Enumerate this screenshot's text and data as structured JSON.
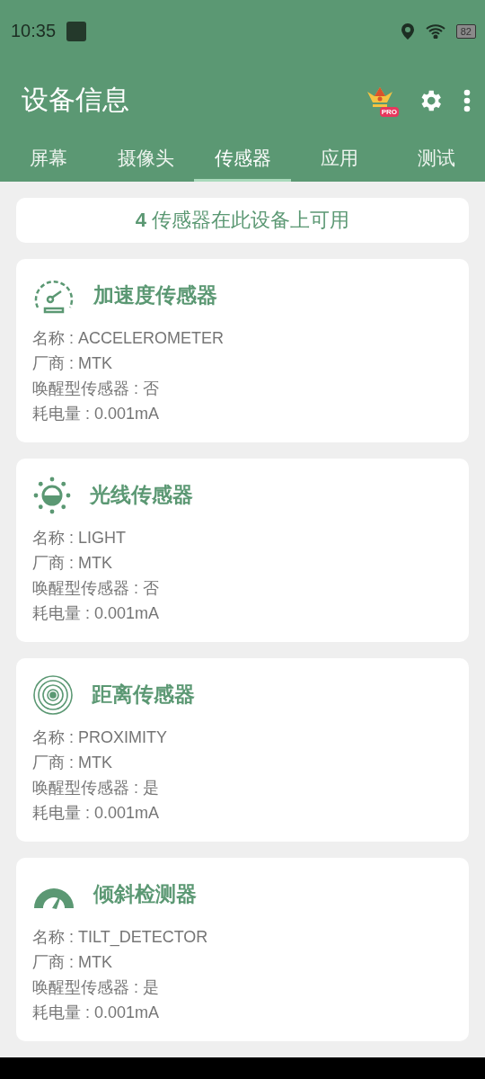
{
  "status_bar": {
    "time": "10:35",
    "battery": "82"
  },
  "toolbar": {
    "title": "设备信息",
    "pro_badge": "PRO"
  },
  "tabs": [
    {
      "label": "屏幕",
      "selected": false
    },
    {
      "label": "摄像头",
      "selected": false
    },
    {
      "label": "传感器",
      "selected": true
    },
    {
      "label": "应用",
      "selected": false
    },
    {
      "label": "测试",
      "selected": false
    }
  ],
  "summary": "**4** 传感器在此设备上可用",
  "sensors": [
    {
      "kind": "speedometer",
      "title": "加速度传感器",
      "lines": [
        "名称 : ACCELEROMETER",
        "厂商 : MTK",
        "唤醒型传感器 : 否",
        "耗电量 : 0.001mA"
      ]
    },
    {
      "kind": "light",
      "title": "光线传感器",
      "lines": [
        "名称 : LIGHT",
        "厂商 : MTK",
        "唤醒型传感器 : 否",
        "耗电量 : 0.001mA"
      ]
    },
    {
      "kind": "proximity",
      "title": "距离传感器",
      "lines": [
        "名称 : PROXIMITY",
        "厂商 : MTK",
        "唤醒型传感器 : 是",
        "耗电量 : 0.001mA"
      ]
    },
    {
      "kind": "tilt",
      "title": "倾斜检测器",
      "lines": [
        "名称 : TILT_DETECTOR",
        "厂商 : MTK",
        "唤醒型传感器 : 是",
        "耗电量 : 0.001mA"
      ]
    }
  ]
}
